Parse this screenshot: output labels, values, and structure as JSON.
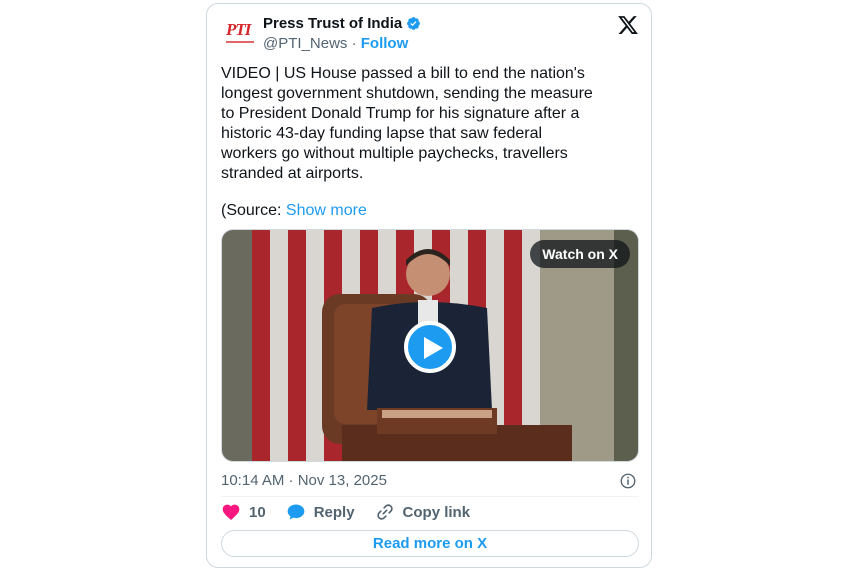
{
  "author": {
    "name": "Press Trust of India",
    "handle": "@PTI_News",
    "separator": "·",
    "follow_label": "Follow",
    "avatar_text": "PTI",
    "avatar_icon": "pti-logo"
  },
  "tweet": {
    "text": "VIDEO | US House passed a bill to end the nation's\nlongest government shutdown, sending the measure\nto President Donald Trump for his signature after a\nhistoric 43-day funding lapse that saw federal\nworkers go without multiple paychecks, travellers\nstranded at airports.",
    "source_prefix": "(Source: ",
    "show_more": "Show more"
  },
  "media": {
    "watch_label": "Watch on X",
    "play_icon": "play-icon"
  },
  "meta": {
    "timestamp": "10:14 AM · Nov 13, 2025",
    "info_icon": "info-icon"
  },
  "actions": {
    "likes": "10",
    "reply_label": "Reply",
    "copy_label": "Copy link"
  },
  "footer": {
    "read_more": "Read more on X"
  },
  "colors": {
    "accent": "#1d9bf0",
    "like": "#f91880",
    "secondary_text": "#536471",
    "border": "#cfd9de"
  }
}
